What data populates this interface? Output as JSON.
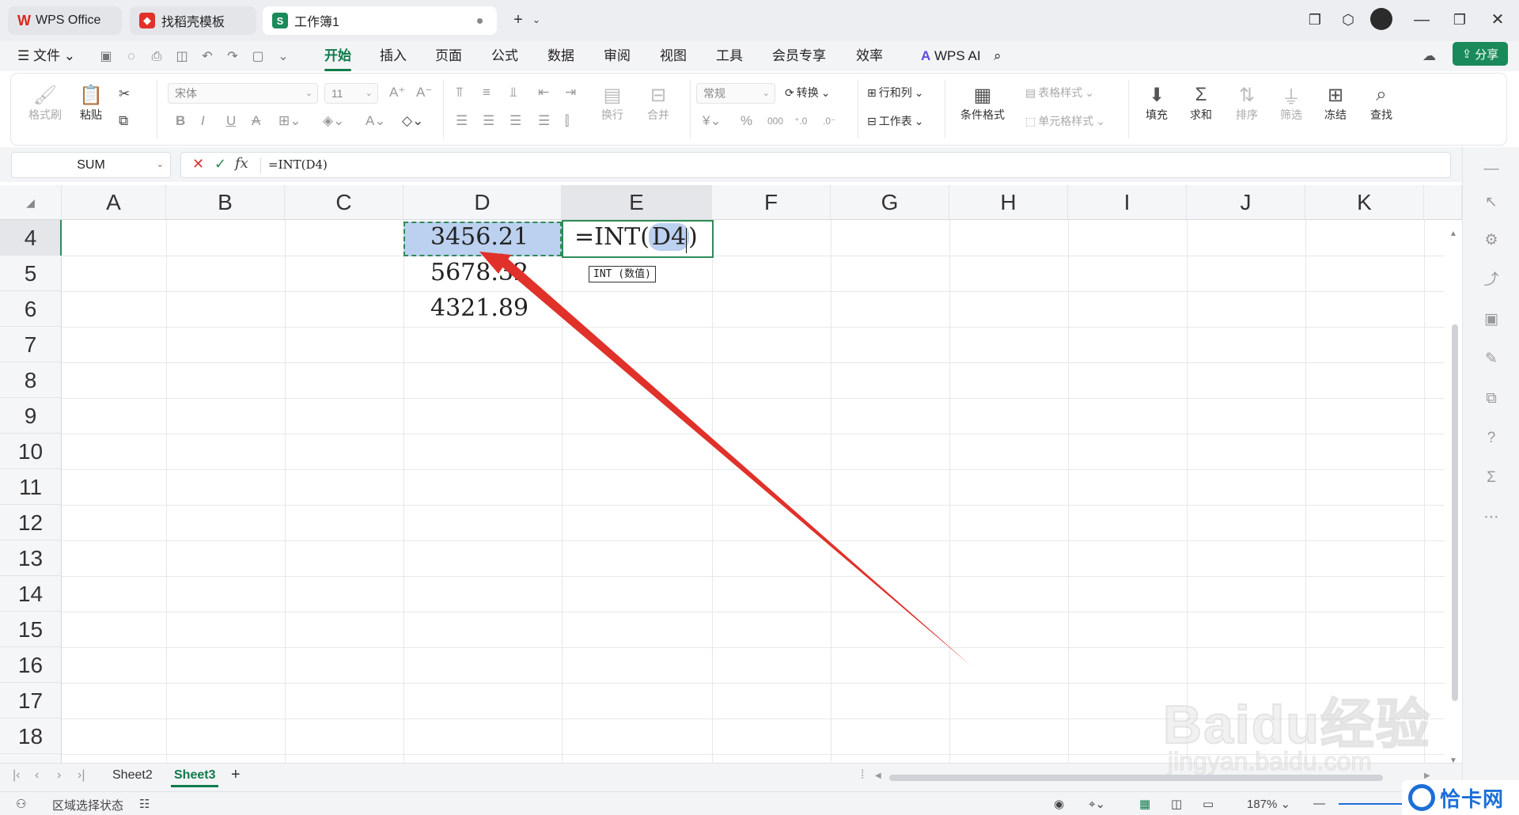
{
  "tabs": [
    {
      "label": "WPS Office",
      "icon": "wps-logo-icon"
    },
    {
      "label": "找稻壳模板",
      "icon": "docer-logo-icon"
    },
    {
      "label": "工作簿1",
      "icon": "spreadsheet-s-icon",
      "badge": "S"
    }
  ],
  "menu": {
    "file": "文件",
    "items": [
      "开始",
      "插入",
      "页面",
      "公式",
      "数据",
      "审阅",
      "视图",
      "工具",
      "会员专享",
      "效率"
    ],
    "active": "开始",
    "wps_ai": "WPS AI",
    "share": "分享"
  },
  "ribbon": {
    "format_painter": "格式刷",
    "paste": "粘贴",
    "font_name": "宋体",
    "font_size": "11",
    "wrap": "换行",
    "merge": "合并",
    "number_format": "常规",
    "convert": "转换",
    "row_col": "行和列",
    "worksheet": "工作表",
    "cond_format": "条件格式",
    "table_style": "表格样式",
    "cell_style": "单元格样式",
    "fill": "填充",
    "sum": "求和",
    "sort": "排序",
    "filter": "筛选",
    "freeze": "冻结",
    "find": "查找"
  },
  "formula_bar": {
    "name_box": "SUM",
    "formula": "=INT(D4)",
    "fx": "fx"
  },
  "columns": [
    "A",
    "B",
    "C",
    "D",
    "E",
    "F",
    "G",
    "H",
    "I",
    "J",
    "K"
  ],
  "selected_column": "E",
  "rows": [
    "4",
    "5",
    "6",
    "7",
    "8",
    "9",
    "10",
    "11",
    "12",
    "13",
    "14",
    "15",
    "16",
    "17",
    "18"
  ],
  "selected_row": "4",
  "cells": {
    "D4": "3456.21",
    "D5": "5678.32",
    "D6": "4321.89",
    "E4_prefix": "=INT(",
    "E4_ref": "D4",
    "E4_suffix": ")"
  },
  "tooltip": "INT (数值)",
  "sheets": [
    "Sheet2",
    "Sheet3"
  ],
  "active_sheet": "Sheet3",
  "status": {
    "mode": "区域选择状态",
    "zoom": "187%"
  },
  "watermark": {
    "text": "Baidu经验",
    "url": "jingyan.baidu.com",
    "corner_logo": "恰卡网"
  },
  "colors": {
    "accent": "#0f7b4a",
    "selection": "#bcd0ef",
    "arrow": "#e0312a"
  }
}
